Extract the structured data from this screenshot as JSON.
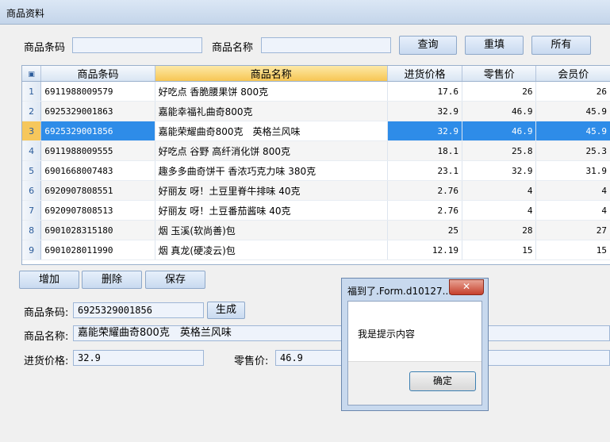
{
  "window": {
    "title": "商品资料"
  },
  "search": {
    "code_label": "商品条码",
    "code_value": "",
    "name_label": "商品名称",
    "name_value": "",
    "query_btn": "查询",
    "reset_btn": "重填",
    "all_btn": "所有"
  },
  "grid": {
    "columns": [
      "商品条码",
      "商品名称",
      "进货价格",
      "零售价",
      "会员价"
    ],
    "rows": [
      {
        "no": "1",
        "code": "6911988009579",
        "name": "好吃点 香脆腰果饼 800克",
        "cost": "17.6",
        "retail": "26",
        "member": "26"
      },
      {
        "no": "2",
        "code": "6925329001863",
        "name": "嘉能幸福礼曲奇800克",
        "cost": "32.9",
        "retail": "46.9",
        "member": "45.9"
      },
      {
        "no": "3",
        "code": "6925329001856",
        "name": "嘉能荣耀曲奇800克　英格兰风味",
        "cost": "32.9",
        "retail": "46.9",
        "member": "45.9"
      },
      {
        "no": "4",
        "code": "6911988009555",
        "name": "好吃点 谷野 高纤消化饼 800克",
        "cost": "18.1",
        "retail": "25.8",
        "member": "25.3"
      },
      {
        "no": "5",
        "code": "6901668007483",
        "name": "趣多多曲奇饼干 香浓巧克力味 380克",
        "cost": "23.1",
        "retail": "32.9",
        "member": "31.9"
      },
      {
        "no": "6",
        "code": "6920907808551",
        "name": "好丽友 呀！土豆里脊牛排味 40克",
        "cost": "2.76",
        "retail": "4",
        "member": "4"
      },
      {
        "no": "7",
        "code": "6920907808513",
        "name": "好丽友 呀！土豆番茄酱味 40克",
        "cost": "2.76",
        "retail": "4",
        "member": "4"
      },
      {
        "no": "8",
        "code": "6901028315180",
        "name": "烟 玉溪(软尚善)包",
        "cost": "25",
        "retail": "28",
        "member": "27"
      },
      {
        "no": "9",
        "code": "6901028011990",
        "name": "烟 真龙(硬凌云)包",
        "cost": "12.19",
        "retail": "15",
        "member": "15"
      }
    ],
    "selected_index": 2
  },
  "actions": {
    "add": "增加",
    "delete": "删除",
    "save": "保存"
  },
  "form": {
    "code_label": "商品条码:",
    "code_value": "6925329001856",
    "generate_btn": "生成",
    "name_label": "商品名称:",
    "name_value": "嘉能荣耀曲奇800克　英格兰风味",
    "cost_label": "进货价格:",
    "cost_value": "32.9",
    "retail_label": "零售价:",
    "retail_value": "46.9"
  },
  "dialog": {
    "title": "福到了.Form.d10127...",
    "message": "我是提示内容",
    "ok": "确定"
  }
}
